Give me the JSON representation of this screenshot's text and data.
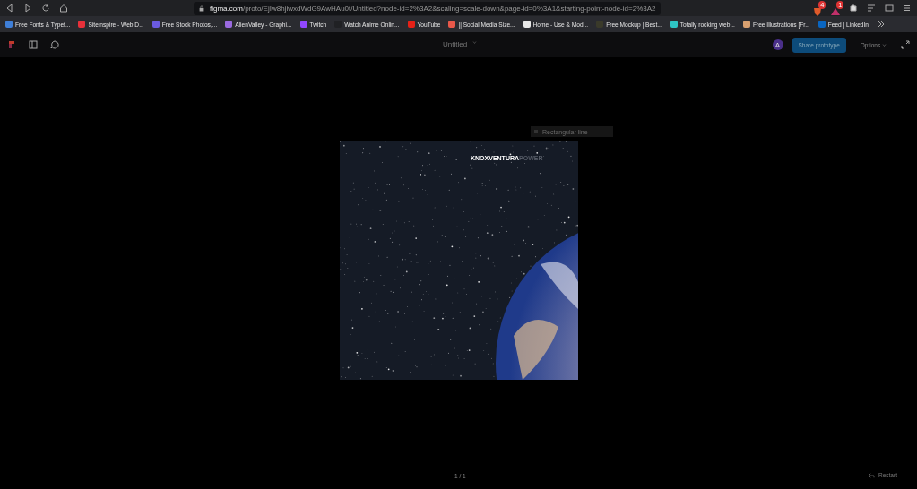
{
  "browser": {
    "url": {
      "domain": "figma.com",
      "path": "/proto/EjIw8hjiwxdWdG9AwHAu0t/Untitled?node-id=2%3A2&scaling=scale-down&page-id=0%3A1&starting-point-node-id=2%3A2"
    },
    "extension_badges": [
      "4",
      "1"
    ],
    "bookmarks": [
      {
        "label": "Free Fonts & Typef...",
        "color": "#3f7fd8"
      },
      {
        "label": "Siteinspire - Web D...",
        "color": "#e8303a"
      },
      {
        "label": "Free Stock Photos,...",
        "color": "#6a5ae0"
      },
      {
        "label": "AlienValley - Graphi...",
        "color": "#9a6ae0"
      },
      {
        "label": "Twitch",
        "color": "#9147ff"
      },
      {
        "label": "Watch Anime Onlin...",
        "color": "#202124"
      },
      {
        "label": "YouTube",
        "color": "#e62117"
      },
      {
        "label": "|| Social Media Size...",
        "color": "#e8584a"
      },
      {
        "label": "Home - Use & Mod...",
        "color": "#e8e8e8"
      },
      {
        "label": "Free Mockup | Best...",
        "color": "#3a3a2a"
      },
      {
        "label": "Totally rocking web...",
        "color": "#2ec4c4"
      },
      {
        "label": "Free Illustrations [Fr...",
        "color": "#d8a070"
      },
      {
        "label": "Feed | LinkedIn",
        "color": "#0a66c2"
      }
    ]
  },
  "toolbar": {
    "title": "Untitled",
    "avatar": "A",
    "share_button": "Share prototype",
    "options": "Options"
  },
  "canvas": {
    "hover_label": "Rectangular line",
    "poster": {
      "brand": "KNOXVENTURA",
      "brand_suffix": "POWER"
    }
  },
  "footer": {
    "page_counter": "1 / 1",
    "restart": "Restart"
  }
}
